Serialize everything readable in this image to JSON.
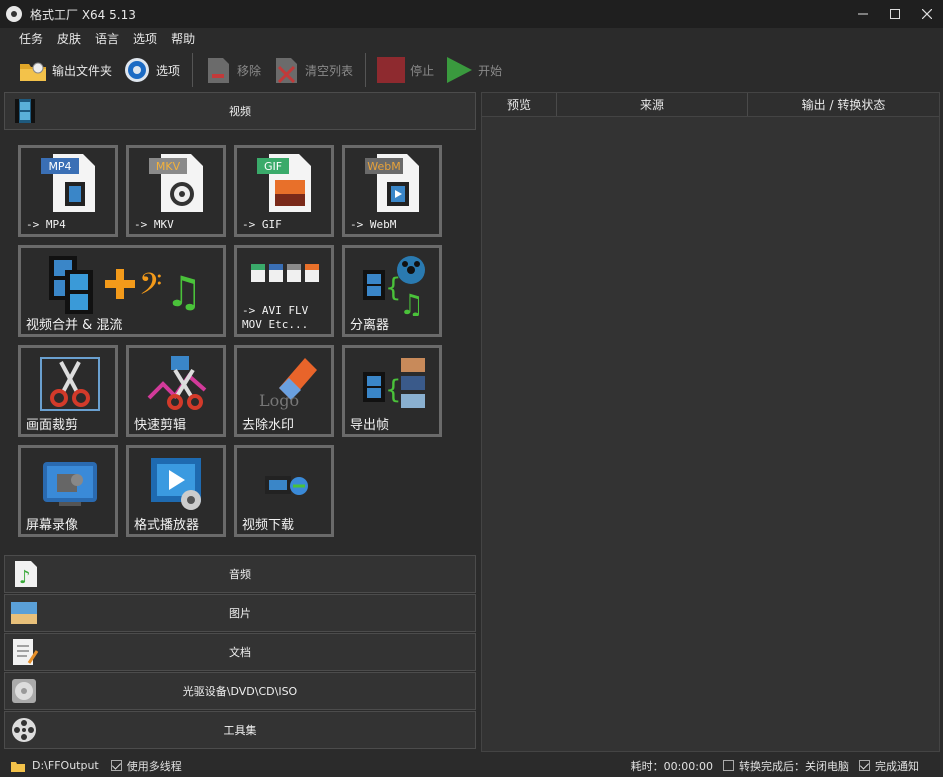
{
  "window": {
    "title": "格式工厂 X64 5.13"
  },
  "menu": [
    "任务",
    "皮肤",
    "语言",
    "选项",
    "帮助"
  ],
  "toolbar": {
    "output_folder": "输出文件夹",
    "options": "选项",
    "remove": "移除",
    "clear_list": "清空列表",
    "stop": "停止",
    "start": "开始"
  },
  "categories": {
    "video": "视频",
    "audio": "音频",
    "image": "图片",
    "document": "文档",
    "rom": "光驱设备\\DVD\\CD\\ISO",
    "tools": "工具集"
  },
  "video_tiles": {
    "mp4": {
      "badge": "MP4",
      "label": "-> MP4"
    },
    "mkv": {
      "badge": "MKV",
      "label": "-> MKV"
    },
    "gif": {
      "badge": "GIF",
      "label": "-> GIF"
    },
    "webm": {
      "badge": "WebM",
      "label": "-> WebM"
    },
    "merge": {
      "label": "视频合并 & 混流"
    },
    "other": {
      "label_line1": "-> AVI FLV",
      "label_line2": "MOV Etc..."
    },
    "splitter": {
      "label": "分离器"
    },
    "crop": {
      "label": "画面裁剪"
    },
    "quick_cut": {
      "label": "快速剪辑"
    },
    "watermark": {
      "label": "去除水印",
      "logo_text": "Logo"
    },
    "export_frames": {
      "label": "导出帧"
    },
    "screen_record": {
      "label": "屏幕录像"
    },
    "player": {
      "label": "格式播放器"
    },
    "download": {
      "label": "视频下载"
    }
  },
  "task_table": {
    "columns": [
      "预览",
      "来源",
      "输出 / 转换状态"
    ]
  },
  "statusbar": {
    "output_path": "D:\\FFOutput",
    "multithread": "使用多线程",
    "elapsed": "耗时：00:00:00",
    "after_convert": "转换完成后：关闭电脑",
    "notify": "完成通知"
  },
  "colors": {
    "background": "#2b2b2b",
    "tile_border": "#6a6a6a",
    "mp4_badge": "#3a6fb5",
    "mkv_badge": "#8a8a8a",
    "gif_badge": "#3aaa6a",
    "webm_text": "#e8a23a"
  }
}
